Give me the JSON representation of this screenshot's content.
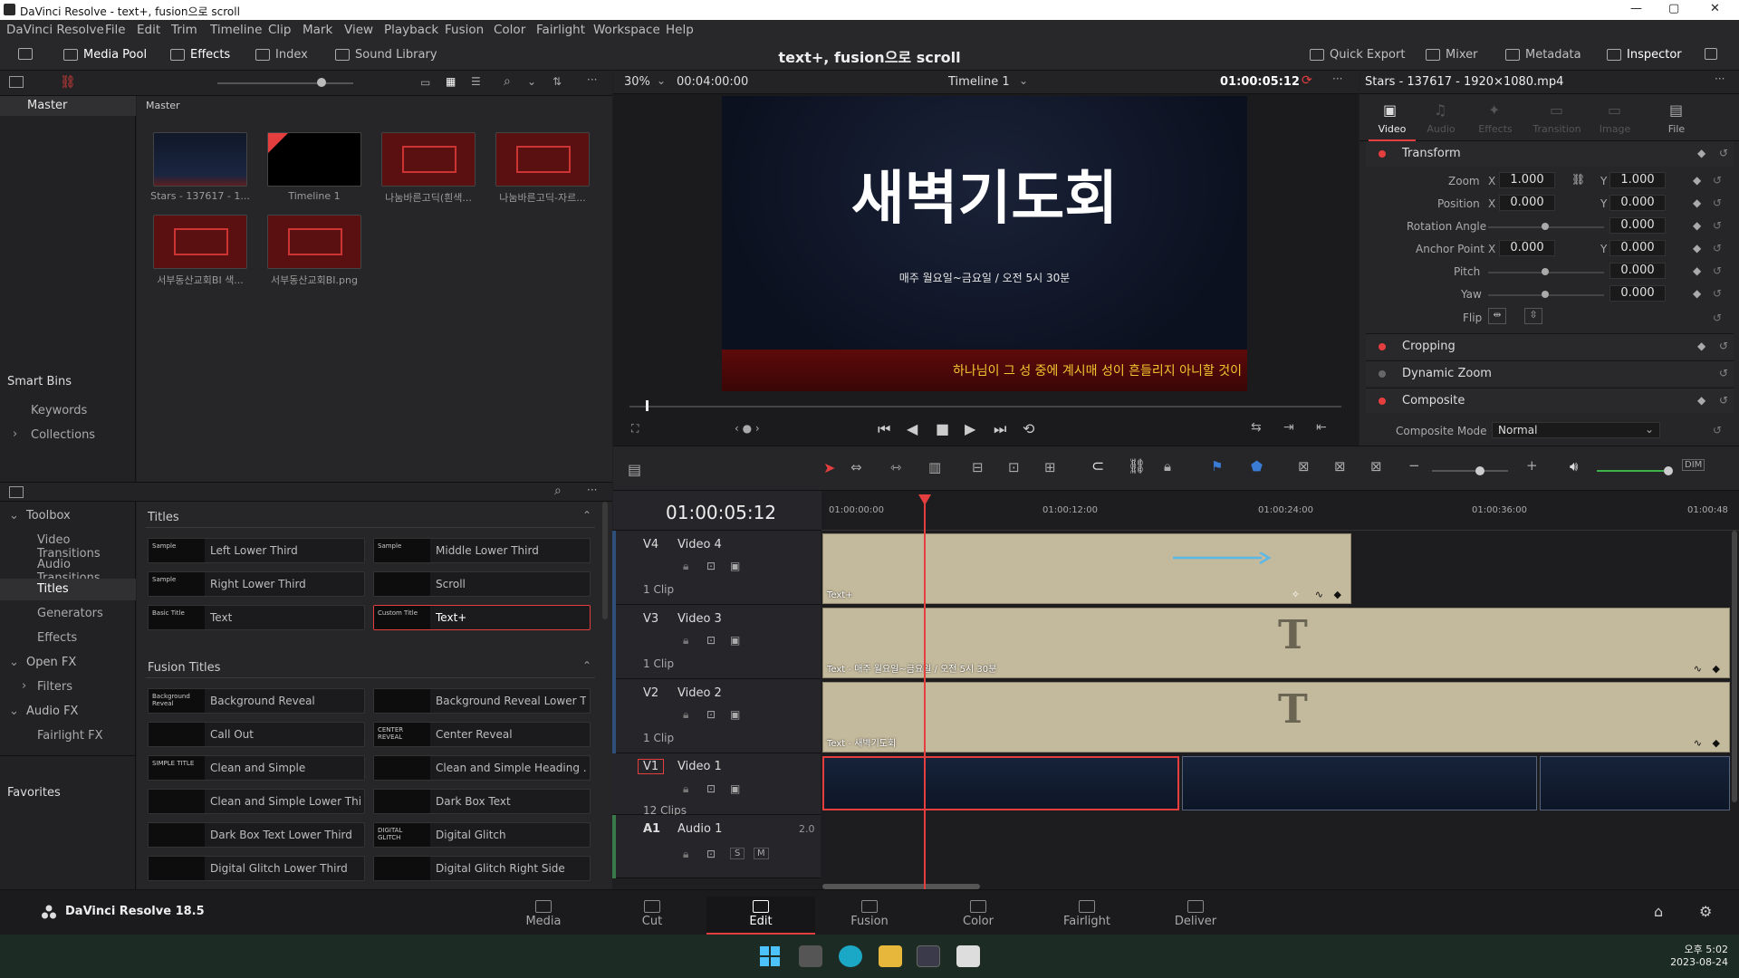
{
  "window": {
    "title": "DaVinci Resolve - text+, fusion으로 scroll"
  },
  "menu": [
    "DaVinci Resolve",
    "File",
    "Edit",
    "Trim",
    "Timeline",
    "Clip",
    "Mark",
    "View",
    "Playback",
    "Fusion",
    "Color",
    "Fairlight",
    "Workspace",
    "Help"
  ],
  "toolbar": {
    "media_pool": "Media Pool",
    "effects": "Effects",
    "index": "Index",
    "sound_library": "Sound Library",
    "project_title": "text+, fusion으로 scroll",
    "quick_export": "Quick Export",
    "mixer": "Mixer",
    "metadata": "Metadata",
    "inspector": "Inspector"
  },
  "media_pool": {
    "bin_title": "Master",
    "header": "Master",
    "smart_bins": "Smart Bins",
    "keywords": "Keywords",
    "collections": "Collections",
    "clips": [
      "Stars - 137617 - 1...",
      "Timeline 1",
      "나눔바른고딕(흰색...",
      "나눔바른고딕-자르...",
      "서부동산교회BI 색...",
      "서부동산교회BI.png"
    ]
  },
  "effects": {
    "tree": [
      "Toolbox",
      "Video Transitions",
      "Audio Transitions",
      "Titles",
      "Generators",
      "Effects",
      "Open FX",
      "Filters",
      "Audio FX",
      "Fairlight FX",
      "Favorites"
    ],
    "titles_header": "Titles",
    "fusion_titles_header": "Fusion Titles",
    "titles": [
      "Left Lower Third",
      "Middle Lower Third",
      "Right Lower Third",
      "Scroll",
      "Text",
      "Text+"
    ],
    "previews": {
      "basic": "Basic Title",
      "custom": "Custom Title",
      "sample": "Sample",
      "background": "Background Reveal",
      "center": "CENTER REVEAL",
      "simple": "SIMPLE TITLE",
      "glitch": "DIGITAL GLITCH"
    },
    "fusion_titles": [
      "Background Reveal",
      "Background Reveal Lower T...",
      "Call Out",
      "Center Reveal",
      "Clean and Simple",
      "Clean and Simple Heading ...",
      "Clean and Simple Lower Thi...",
      "Dark Box Text",
      "Dark Box Text Lower Third",
      "Digital Glitch",
      "Digital Glitch Lower Third",
      "Digital Glitch Right Side"
    ]
  },
  "viewer": {
    "zoom": "30%",
    "duration": "00:04:00:00",
    "timeline_name": "Timeline 1",
    "timecode": "01:00:05:12",
    "main_text": "새벽기도회",
    "sub_text": "매주 월요일~금요일 / 오전 5시 30분",
    "scroll_text": "하나님이 그 성 중에 계시매 성이 흔들리지 아니할 것이"
  },
  "inspector": {
    "clip_name": "Stars - 137617 - 1920×1080.mp4",
    "tabs": [
      "Video",
      "Audio",
      "Effects",
      "Transition",
      "Image",
      "File"
    ],
    "sections": {
      "transform": "Transform",
      "cropping": "Cropping",
      "dynamic_zoom": "Dynamic Zoom",
      "composite": "Composite"
    },
    "labels": {
      "zoom": "Zoom",
      "position": "Position",
      "rotation": "Rotation Angle",
      "anchor": "Anchor Point",
      "pitch": "Pitch",
      "yaw": "Yaw",
      "flip": "Flip",
      "composite_mode": "Composite Mode",
      "x": "X",
      "y": "Y"
    },
    "values": {
      "zoom_x": "1.000",
      "zoom_y": "1.000",
      "pos_x": "0.000",
      "pos_y": "0.000",
      "rotation": "0.000",
      "anchor_x": "0.000",
      "anchor_y": "0.000",
      "pitch": "0.000",
      "yaw": "0.000",
      "composite_mode": "Normal"
    }
  },
  "timeline": {
    "timecode": "01:00:05:12",
    "ruler": [
      "01:00:00:00",
      "01:00:12:00",
      "01:00:24:00",
      "01:00:36:00",
      "01:00:48"
    ],
    "tracks": [
      {
        "id": "V4",
        "name": "Video 4",
        "clips": "1 Clip",
        "clip_label": "Text+"
      },
      {
        "id": "V3",
        "name": "Video 3",
        "clips": "1 Clip",
        "clip_label": "Text - 매주 월요일~금요일 / 오전 5시 30분"
      },
      {
        "id": "V2",
        "name": "Video 2",
        "clips": "1 Clip",
        "clip_label": "Text - 새벽기도회"
      },
      {
        "id": "V1",
        "name": "Video 1",
        "clips": "12 Clips",
        "clip_label": ""
      },
      {
        "id": "A1",
        "name": "Audio 1",
        "clips": "2.0",
        "clip_label": ""
      }
    ],
    "track_t_glyph": "T",
    "solo": "S",
    "mute": "M"
  },
  "pages": {
    "brand": "DaVinci Resolve 18.5",
    "items": [
      "Media",
      "Cut",
      "Edit",
      "Fusion",
      "Color",
      "Fairlight",
      "Deliver"
    ],
    "active": "Edit"
  },
  "taskbar": {
    "time": "오후 5:02",
    "date": "2023-08-24"
  }
}
